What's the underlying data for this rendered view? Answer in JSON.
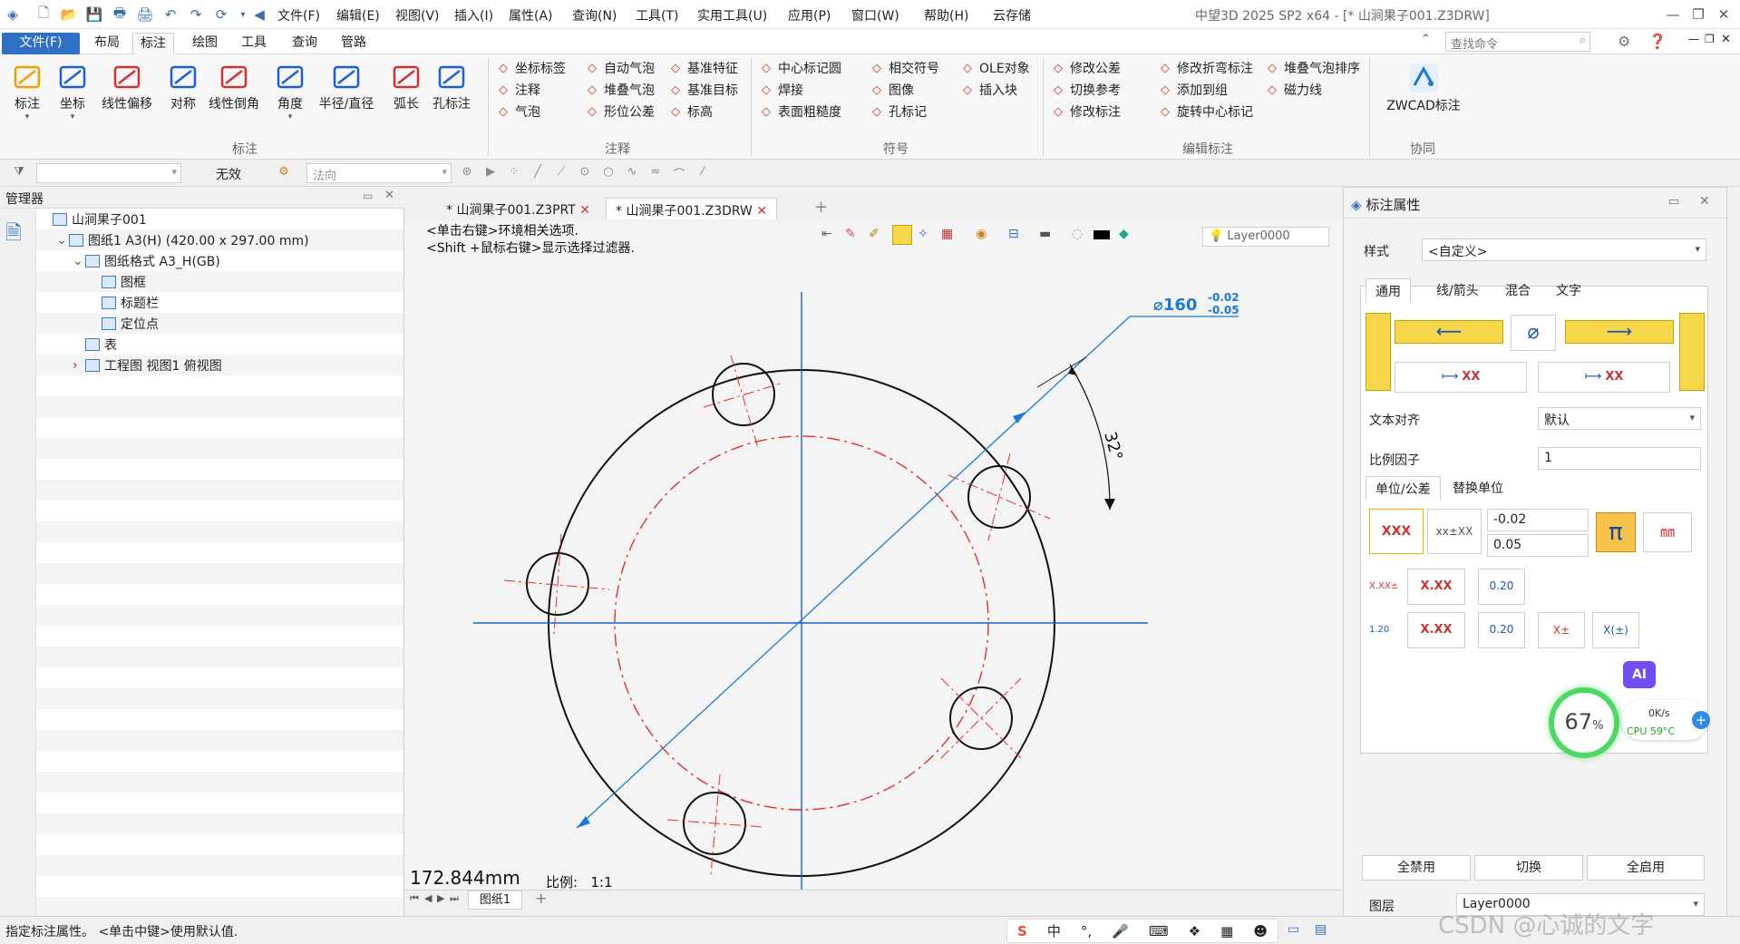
{
  "titlebar": {
    "title": "中望3D 2025 SP2 x64 - [* 山涧果子001.Z3DRW]",
    "menus": [
      "文件(F)",
      "编辑(E)",
      "视图(V)",
      "插入(I)",
      "属性(A)",
      "查询(N)",
      "工具(T)",
      "实用工具(U)",
      "应用(P)",
      "窗口(W)",
      "帮助(H)",
      "云存储"
    ]
  },
  "ribbon_tabs": [
    "文件(F)",
    "布局",
    "标注",
    "绘图",
    "工具",
    "查询",
    "管路"
  ],
  "search": {
    "placeholder": "查找命令"
  },
  "ribbon": {
    "biao_zhu": {
      "big": [
        "标注",
        "坐标",
        "线性偏移",
        "对称",
        "线性倒角",
        "角度",
        "半径/直径",
        "弧长",
        "孔标注"
      ],
      "label": "标注"
    },
    "zhushi": {
      "items": [
        "坐标标签",
        "自动气泡",
        "基准特征",
        "注释",
        "堆叠气泡",
        "基准目标",
        "气泡",
        "形位公差",
        "标高"
      ],
      "label": "注释"
    },
    "fuhao": {
      "items": [
        "中心标记圆",
        "相交符号",
        "OLE对象",
        "焊接",
        "图像",
        "插入块",
        "表面粗糙度",
        "孔标记"
      ],
      "label": "符号"
    },
    "bianji": {
      "items": [
        "修改公差",
        "修改折弯标注",
        "堆叠气泡排序",
        "切换参考",
        "添加到组",
        "磁力线",
        "修改标注",
        "旋转中心标记"
      ],
      "label": "编辑标注"
    },
    "xietong": {
      "big": "ZWCAD标注",
      "label": "协同"
    }
  },
  "toolbar": {
    "filter_value": "无效",
    "direction_placeholder": "法向"
  },
  "manager": {
    "title": "管理器",
    "tree": [
      {
        "label": "山涧果子001",
        "indent": 0
      },
      {
        "label": "图纸1 A3(H) (420.00 x 297.00 mm)",
        "indent": 1
      },
      {
        "label": "图纸格式 A3_H(GB)",
        "indent": 2
      },
      {
        "label": "图框",
        "indent": 3
      },
      {
        "label": "标题栏",
        "indent": 3
      },
      {
        "label": "定位点",
        "indent": 3
      },
      {
        "label": "表",
        "indent": 2
      },
      {
        "label": "工程图 视图1 俯视图",
        "indent": 2
      }
    ]
  },
  "doc_tabs": [
    "* 山涧果子001.Z3PRT",
    "* 山涧果子001.Z3DRW"
  ],
  "canvas": {
    "hint1": "<单击右键>环境相关选项.",
    "hint2": "<Shift +鼠标右键>显示选择过滤器.",
    "layer": "Layer0000",
    "measure": "172.844mm",
    "scale_label": "比例:",
    "scale_value": "1:1",
    "dim_main": "⌀160",
    "dim_upper": "-0.02",
    "dim_lower": "-0.05",
    "angle_dim": "32°"
  },
  "sheet_tab": "图纸1",
  "props": {
    "title": "标注属性",
    "style_label": "样式",
    "style_value": "<自定义>",
    "tabs": [
      "通用",
      "线/箭头",
      "混合",
      "文字"
    ],
    "text_align_label": "文本对齐",
    "text_align_value": "默认",
    "scale_label": "比例因子",
    "scale_value": "1",
    "subtabs": [
      "单位/公差",
      "替换单位"
    ],
    "tol_upper": "-0.02",
    "tol_lower": "0.05",
    "fmt_xxx": "XXX",
    "fmt_xx": "X.XX",
    "fmt_020": "0.20",
    "ai_label": "AI",
    "btn_disable_all": "全禁用",
    "btn_toggle": "切换",
    "btn_enable_all": "全启用",
    "layer_label": "图层",
    "layer_value": "Layer0000"
  },
  "gauge": {
    "percent": "67",
    "unit": "%",
    "speed": "0K/s",
    "cpu": "CPU 59°C"
  },
  "status": {
    "text": "指定标注属性。 <单击中键>使用默认值.",
    "ime": "中"
  },
  "watermark": "CSDN @心诚的文字",
  "colors": {
    "accent": "#2f6fc4",
    "construction": "#e03030",
    "dim": "#1a7ad6"
  }
}
